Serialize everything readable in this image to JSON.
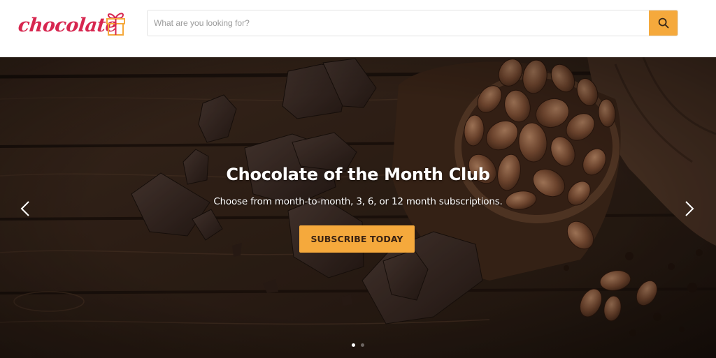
{
  "header": {
    "logo_text": "chocolate",
    "search": {
      "placeholder": "What are you looking for?",
      "value": ""
    }
  },
  "hero": {
    "title": "Chocolate of the Month Club",
    "subtitle": "Choose from month-to-month, 3, 6, or 12 month subscriptions.",
    "cta_label": "SUBSCRIBE TODAY"
  },
  "carousel": {
    "slide_count": 2,
    "active_index": 0
  },
  "icons": {
    "search_button": "search-icon",
    "prev": "chevron-left-icon",
    "next": "chevron-right-icon",
    "logo": "gift-box-icon"
  },
  "colors": {
    "brand": "#d7264f",
    "accent": "#f5a93c",
    "hero_bg": "#2b1d14"
  }
}
